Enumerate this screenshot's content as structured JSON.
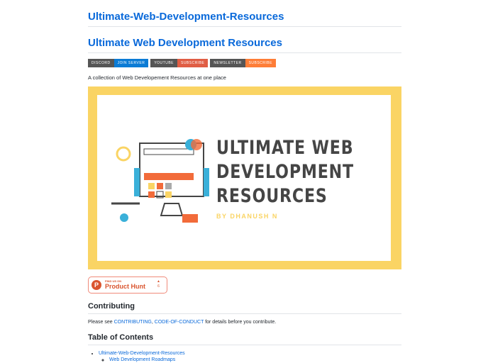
{
  "repo_title": "Ultimate-Web-Development-Resources",
  "readme_title": "Ultimate Web Development Resources",
  "badges": [
    {
      "label": "DISCORD",
      "action": "JOIN SERVER",
      "color": "#0b7bd5"
    },
    {
      "label": "YOUTUBE",
      "action": "SUBSCRIBE",
      "color": "#e05d44"
    },
    {
      "label": "NEWSLETTER",
      "action": "SUBSCRIBE",
      "color": "#fe7d37"
    }
  ],
  "description": "A collection of Web Developement Resources at one place",
  "banner": {
    "line1": "ULTIMATE WEB",
    "line2": "DEVELOPMENT",
    "line3": "RESOURCES",
    "byline": "BY DHANUSH N"
  },
  "product_hunt": {
    "letter": "P",
    "find": "FIND US ON",
    "name": "Product Hunt",
    "votes": "6"
  },
  "contributing": {
    "heading": "Contributing",
    "prefix": "Please see ",
    "link1": "CONTRIBUTING",
    "sep": ", ",
    "link2": "CODE-OF-CONDUCT",
    "suffix": " for details before you contribute."
  },
  "toc": {
    "heading": "Table of Contents",
    "item1": "Ultimate-Web-Development-Resources",
    "sub1": "Web Development Roadmaps"
  }
}
